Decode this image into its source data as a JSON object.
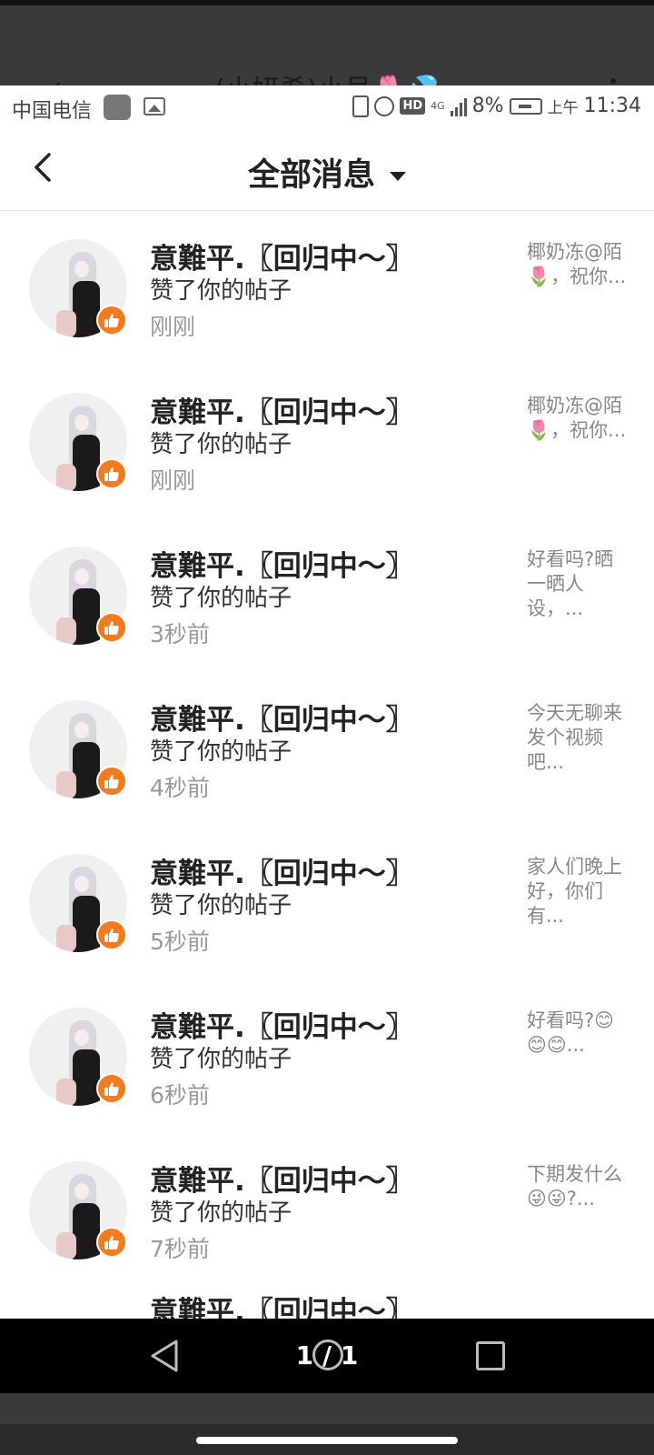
{
  "overlay": {
    "ghost_title": "(小妍希)小号🌷💦"
  },
  "status_bar": {
    "carrier": "中国电信",
    "network": "4G",
    "battery": "8%",
    "ampm": "上午",
    "time": "11:34"
  },
  "header": {
    "title": "全部消息"
  },
  "messages": [
    {
      "name": "意難平.〖回归中〜〗",
      "action": "赞了你的帖子",
      "time": "刚刚",
      "preview": "椰奶冻@陌🌷，祝你..."
    },
    {
      "name": "意難平.〖回归中〜〗",
      "action": "赞了你的帖子",
      "time": "刚刚",
      "preview": "椰奶冻@陌🌷，祝你..."
    },
    {
      "name": "意難平.〖回归中〜〗",
      "action": "赞了你的帖子",
      "time": "3秒前",
      "preview": "好看吗?晒一晒人设，..."
    },
    {
      "name": "意難平.〖回归中〜〗",
      "action": "赞了你的帖子",
      "time": "4秒前",
      "preview": "今天无聊来发个视频吧..."
    },
    {
      "name": "意難平.〖回归中〜〗",
      "action": "赞了你的帖子",
      "time": "5秒前",
      "preview": "家人们晚上好，你们有..."
    },
    {
      "name": "意難平.〖回归中〜〗",
      "action": "赞了你的帖子",
      "time": "6秒前",
      "preview": "好看吗?😊😊😊..."
    },
    {
      "name": "意難平.〖回归中〜〗",
      "action": "赞了你的帖子",
      "time": "7秒前",
      "preview": "下期发什么😜😜?..."
    }
  ],
  "partial_row": {
    "name": "意難平.〖回归中〜〗"
  },
  "viewer": {
    "page_counter": "1 / 1"
  },
  "colors": {
    "like_badge": "#f57a1c",
    "title_text": "#222222",
    "secondary_text": "#999999"
  }
}
